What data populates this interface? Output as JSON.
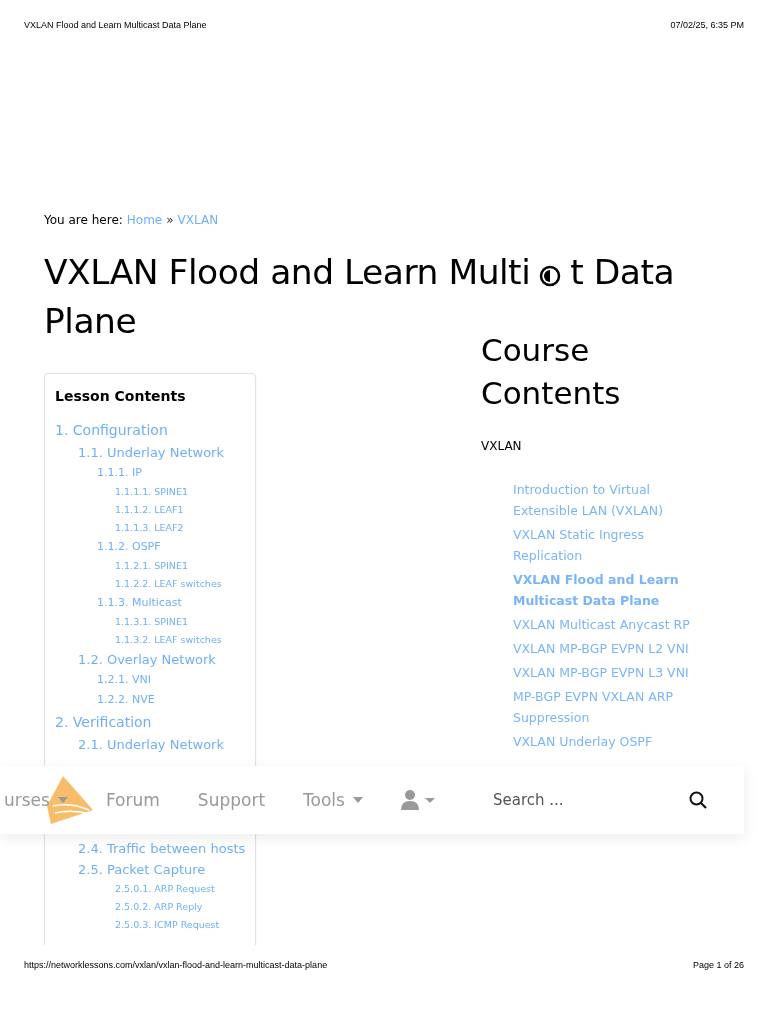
{
  "print_header": {
    "title": "VXLAN Flood and Learn Multicast Data Plane",
    "date": "07/02/25, 6:35 PM"
  },
  "breadcrumb": {
    "label": "You are here:",
    "links": [
      "Home",
      "VXLAN"
    ],
    "separator": "»"
  },
  "page_title": {
    "before_icon": "VXLAN Flood and Learn Multi",
    "after_icon": "t Data",
    "line_2": "Plane"
  },
  "lesson_contents": {
    "title": "Lesson Contents",
    "items": [
      {
        "label": "1. Configuration",
        "children": [
          {
            "label": "1.1. Underlay Network",
            "children": [
              {
                "label": "1.1.1. IP",
                "children": [
                  {
                    "label": "1.1.1.1. SPINE1"
                  },
                  {
                    "label": "1.1.1.2. LEAF1"
                  },
                  {
                    "label": "1.1.1.3. LEAF2"
                  }
                ]
              },
              {
                "label": "1.1.2. OSPF",
                "children": [
                  {
                    "label": "1.1.2.1. SPINE1"
                  },
                  {
                    "label": "1.1.2.2. LEAF switches"
                  }
                ]
              },
              {
                "label": "1.1.3. Multicast",
                "children": [
                  {
                    "label": "1.1.3.1. SPINE1"
                  },
                  {
                    "label": "1.1.3.2. LEAF switches"
                  }
                ]
              }
            ]
          },
          {
            "label": "1.2. Overlay Network",
            "children": [
              {
                "label": "1.2.1. VNI"
              },
              {
                "label": "1.2.2. NVE"
              }
            ]
          }
        ]
      },
      {
        "label": "2. Verification",
        "children": [
          {
            "label": "2.1. Underlay Network"
          },
          {
            "label": "2.4. Traffic between hosts"
          },
          {
            "label": "2.5. Packet Capture",
            "children": [
              {
                "children": [
                  {
                    "label": "2.5.0.1. ARP Request"
                  },
                  {
                    "label": "2.5.0.2. ARP Reply"
                  },
                  {
                    "label": "2.5.0.3. ICMP Request"
                  }
                ]
              }
            ]
          }
        ]
      }
    ]
  },
  "course_contents": {
    "title": "Course Contents",
    "course": "VXLAN",
    "lessons": [
      {
        "label": "Introduction to Virtual Extensible LAN (VXLAN)",
        "selected": false
      },
      {
        "label": "VXLAN Static Ingress Replication",
        "selected": false
      },
      {
        "label": "VXLAN Flood and Learn Multicast Data Plane",
        "selected": true
      },
      {
        "label": "VXLAN Multicast Anycast RP",
        "selected": false
      },
      {
        "label": "VXLAN MP-BGP EVPN L2 VNI",
        "selected": false
      },
      {
        "label": "VXLAN MP-BGP EVPN L3 VNI",
        "selected": false
      },
      {
        "label": "MP-BGP EVPN VXLAN ARP Suppression",
        "selected": false
      },
      {
        "label": "VXLAN Underlay OSPF",
        "selected": false
      }
    ]
  },
  "nav_bar": {
    "items": [
      {
        "label": "urses",
        "kind": "dropdown"
      },
      {
        "label": "Forum",
        "kind": "link"
      },
      {
        "label": "Support",
        "kind": "link"
      },
      {
        "label": "Tools",
        "kind": "dropdown"
      },
      {
        "kind": "account"
      }
    ],
    "search": {
      "placeholder": "Search ..."
    }
  },
  "print_footer": {
    "url": "https://networklessons.com/vxlan/vxlan-flood-and-learn-multicast-data-plane",
    "page": "Page 1 of 26"
  }
}
